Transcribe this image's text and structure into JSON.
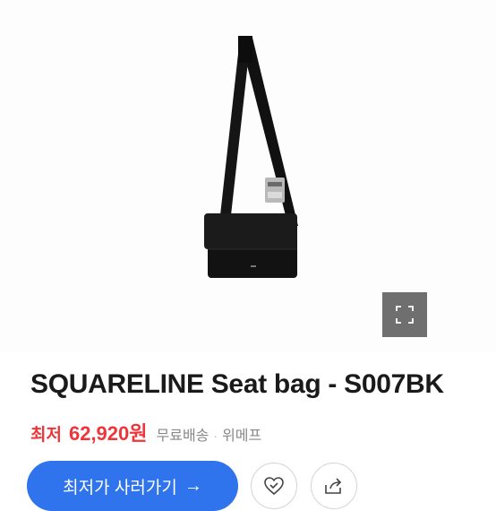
{
  "product": {
    "title": "SQUARELINE Seat bag - S007BK",
    "image_alt": "black crossbody seat bag"
  },
  "price": {
    "label": "최저",
    "value": "62,920원",
    "shipping": "무료배송",
    "seller": "위메프",
    "separator": "·"
  },
  "actions": {
    "buy_label": "최저가 사러가기",
    "buy_arrow": "→"
  },
  "colors": {
    "accent": "#2f74ed",
    "price": "#f0353a",
    "expand_bg": "#6f6f6f"
  },
  "icons": {
    "expand": "expand-icon",
    "wish": "heart-check-icon",
    "share": "share-icon"
  }
}
